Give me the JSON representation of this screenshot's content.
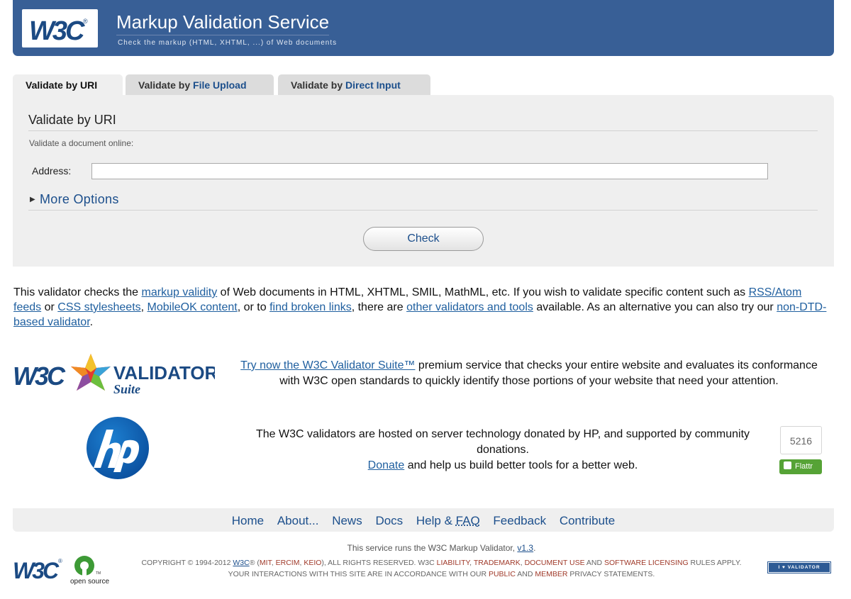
{
  "banner": {
    "logo_text": "W3C",
    "title": "Markup Validation Service",
    "subtitle": "Check the markup (HTML, XHTML, ...) of Web documents"
  },
  "tabs": [
    {
      "prefix": "Validate by ",
      "keyword": "URI",
      "active": true
    },
    {
      "prefix": "Validate by ",
      "keyword": "File Upload",
      "active": false
    },
    {
      "prefix": "Validate by ",
      "keyword": "Direct Input",
      "active": false
    }
  ],
  "panel": {
    "title": "Validate by URI",
    "intro": "Validate a document online:",
    "address_label": "Address:",
    "address_value": "",
    "more_options": "More Options",
    "check_label": "Check"
  },
  "intro": {
    "t1": "This validator checks the ",
    "l1": "markup validity",
    "t2": " of Web documents in HTML, XHTML, SMIL, MathML, etc. If you wish to validate specific content such as ",
    "l2": "RSS/Atom feeds",
    "t3": " or ",
    "l3": "CSS stylesheets",
    "t4": ", ",
    "l4": "MobileOK content",
    "t5": ", or to ",
    "l5": "find broken links",
    "t6": ", there are ",
    "l6": "other validators and tools",
    "t7": " available. As an alternative you can also try our ",
    "l7": "non-DTD-based validator",
    "t8": "."
  },
  "suite": {
    "logo_w3c": "W3C",
    "logo_validator": "VALIDATOR",
    "logo_suite": "Suite",
    "link": "Try now the W3C Validator Suite™",
    "text": " premium service that checks your entire website and evaluates its conformance with W3C open standards to quickly identify those portions of your website that need your attention."
  },
  "hp": {
    "text1": "The W3C validators are hosted on server technology donated by HP, and supported by community donations.",
    "donate": "Donate",
    "text2": " and help us build better tools for a better web.",
    "flattr_count": "5216",
    "flattr_label": "Flattr"
  },
  "footer_nav": {
    "home": "Home",
    "about": "About...",
    "news": "News",
    "docs": "Docs",
    "help_prefix": "Help & ",
    "help_abbr": "FAQ",
    "feedback": "Feedback",
    "contribute": "Contribute"
  },
  "footer": {
    "service_text": "This service runs the W3C Markup Validator, ",
    "version": "v1.3",
    "service_end": ".",
    "oss_text": "open source",
    "c1": "COPYRIGHT © 1994-2012 ",
    "c_w3c": "W3C",
    "c2": "® (",
    "c_mit": "MIT",
    "c3": ", ",
    "c_ercim": "ERCIM",
    "c4": ", ",
    "c_keio": "KEIO",
    "c5": "), ALL RIGHTS RESERVED. W3C ",
    "c_liability": "LIABILITY",
    "c6": ", ",
    "c_trademark": "TRADEMARK",
    "c7": ", ",
    "c_docuse": "DOCUMENT USE",
    "c8": " AND ",
    "c_software": "SOFTWARE LICENSING",
    "c9": " RULES APPLY. YOUR INTERACTIONS WITH THIS SITE ARE IN ACCORDANCE WITH OUR ",
    "c_public": "PUBLIC",
    "c10": " AND ",
    "c_member": "MEMBER",
    "c11": " PRIVACY STATEMENTS.",
    "badge": "I ♥ VALIDATOR"
  },
  "colors": {
    "banner_bg": "#385f96",
    "link": "#1c4f8c",
    "panel_bg": "#efefef",
    "flattr_green": "#56a336"
  }
}
